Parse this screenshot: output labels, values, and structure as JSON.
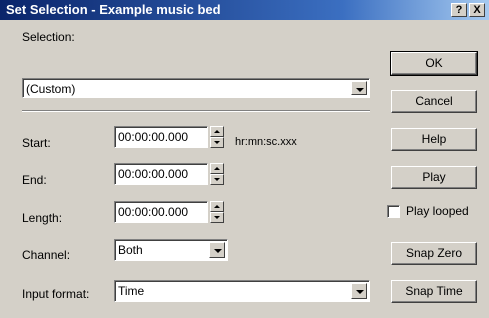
{
  "window": {
    "title": "Set Selection - Example music bed"
  },
  "titlebar_buttons": {
    "help": "?",
    "close": "X"
  },
  "selection": {
    "label": "Selection:",
    "value": "(Custom)"
  },
  "fields": {
    "start": {
      "label": "Start:",
      "value": "00:00:00.000",
      "hint": "hr:mn:sc.xxx"
    },
    "end": {
      "label": "End:",
      "value": "00:00:00.000"
    },
    "length": {
      "label": "Length:",
      "value": "00:00:00.000"
    },
    "channel": {
      "label": "Channel:",
      "value": "Both"
    },
    "input_format": {
      "label": "Input format:",
      "value": "Time"
    }
  },
  "buttons": {
    "ok": "OK",
    "cancel": "Cancel",
    "help": "Help",
    "play": "Play",
    "play_looped": "Play looped",
    "snap_zero": "Snap Zero",
    "snap_time": "Snap Time"
  },
  "play_looped_checked": false
}
